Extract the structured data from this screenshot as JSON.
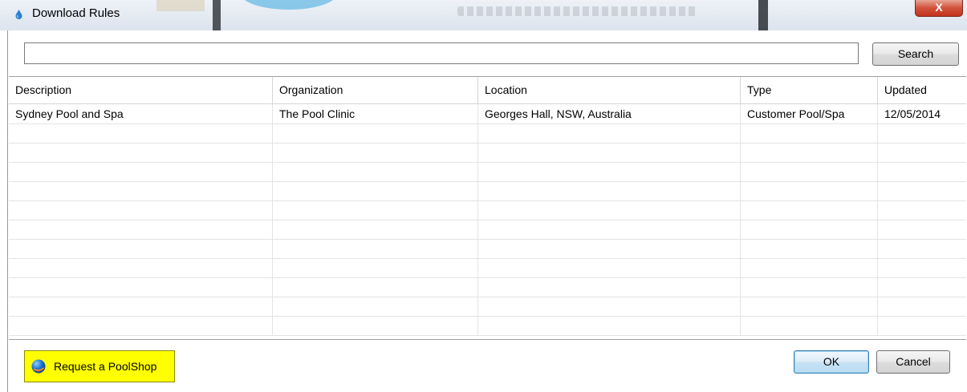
{
  "window": {
    "title": "Download Rules",
    "close_glyph": "X"
  },
  "search": {
    "value": "",
    "placeholder": "",
    "button_label": "Search"
  },
  "table": {
    "columns": [
      "Description",
      "Organization",
      "Location",
      "Type",
      "Updated"
    ],
    "rows": [
      [
        "Sydney Pool and Spa",
        "The Pool Clinic",
        "Georges Hall, NSW, Australia",
        "Customer Pool/Spa",
        "12/05/2014"
      ]
    ]
  },
  "footer": {
    "request_label": "Request a PoolShop",
    "ok_label": "OK",
    "cancel_label": "Cancel"
  },
  "colors": {
    "request_button_bg": "#ffff00",
    "close_button": "#c2331c"
  },
  "icons": {
    "title": "water-drop-icon",
    "request": "globe-icon",
    "close": "close-icon"
  }
}
